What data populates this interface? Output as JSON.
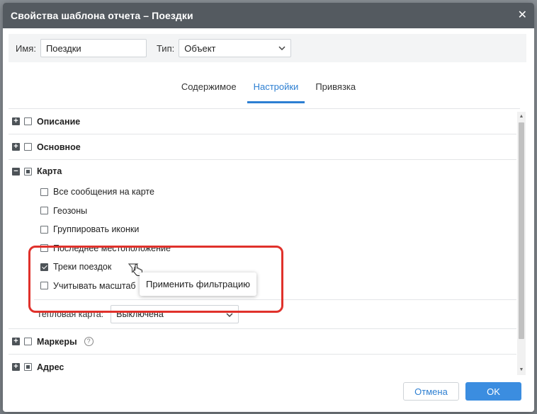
{
  "dialog": {
    "title": "Свойства шаблона отчета – Поездки",
    "close_symbol": "✕"
  },
  "name_bar": {
    "name_label": "Имя:",
    "name_value": "Поездки",
    "type_label": "Тип:",
    "type_value": "Объект"
  },
  "tabs": [
    {
      "label": "Содержимое",
      "active": false
    },
    {
      "label": "Настройки",
      "active": true
    },
    {
      "label": "Привязка",
      "active": false
    }
  ],
  "sections": {
    "description": {
      "label": "Описание",
      "expander": "+",
      "state": "unchecked"
    },
    "basic": {
      "label": "Основное",
      "expander": "+",
      "state": "unchecked"
    },
    "map": {
      "label": "Карта",
      "expander": "−",
      "state": "partial",
      "items": [
        {
          "label": "Все сообщения на карте",
          "checked": false
        },
        {
          "label": "Геозоны",
          "checked": false
        },
        {
          "label": "Группировать иконки",
          "checked": false
        },
        {
          "label": "Последнее местоположение",
          "checked": false
        },
        {
          "label": "Треки поездок",
          "checked": true
        },
        {
          "label": "Учитывать масштаб",
          "checked": false
        }
      ],
      "heatmap_label": "Тепловая карта:",
      "heatmap_value": "Выключена"
    },
    "markers": {
      "label": "Маркеры",
      "expander": "+",
      "state": "unchecked",
      "help": "?"
    },
    "address": {
      "label": "Адрес",
      "expander": "+",
      "state": "partial"
    }
  },
  "tooltip": {
    "text": "Применить фильтрацию"
  },
  "footer": {
    "cancel_label": "Отмена",
    "ok_label": "OK"
  },
  "icons": {
    "filter": "filter-funnel-icon",
    "cursor": "hand-pointer-icon",
    "highlight_color": "#e0312b"
  }
}
